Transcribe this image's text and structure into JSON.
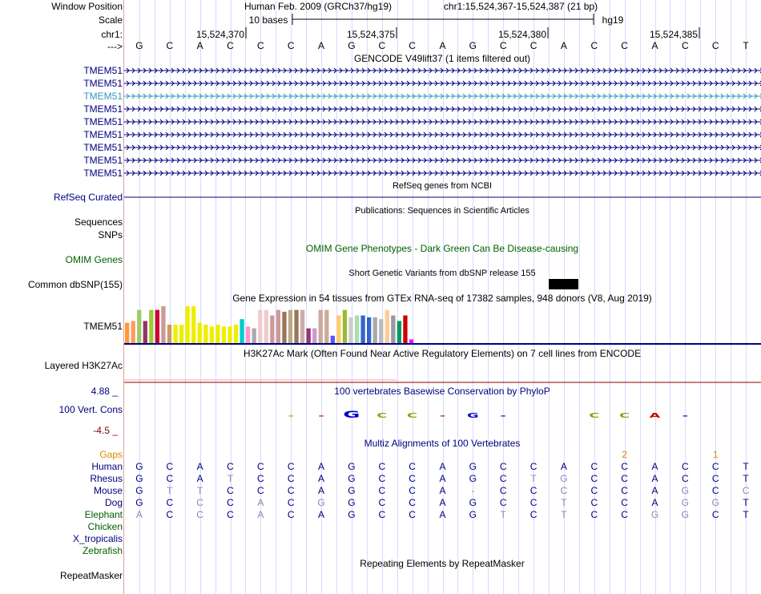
{
  "header": {
    "window_position_label": "Window Position",
    "assembly": "Human Feb. 2009 (GRCh37/hg19)",
    "position": "chr1:15,524,367-15,524,387 (21 bp)",
    "scale_label": "Scale",
    "scale_text": "10 bases",
    "scale_db": "hg19",
    "chrom_label": "chr1:",
    "strand_label": "--->",
    "ticks": [
      "15,524,370",
      "15,524,375",
      "15,524,380",
      "15,524,385"
    ]
  },
  "sequence": [
    "G",
    "C",
    "A",
    "C",
    "C",
    "C",
    "A",
    "G",
    "C",
    "C",
    "A",
    "G",
    "C",
    "C",
    "A",
    "C",
    "C",
    "A",
    "C",
    "C",
    "T"
  ],
  "gencode": {
    "title": "GENCODE V49lift37 (1 items filtered out)",
    "items": [
      "TMEM51",
      "TMEM51",
      "TMEM51",
      "TMEM51",
      "TMEM51",
      "TMEM51",
      "TMEM51",
      "TMEM51",
      "TMEM51"
    ],
    "highlight_index": 2
  },
  "refseq": {
    "title": "RefSeq genes from NCBI",
    "label": "RefSeq Curated"
  },
  "publications": {
    "title": "Publications: Sequences in Scientific Articles",
    "labels": [
      "Sequences",
      "SNPs"
    ]
  },
  "omim": {
    "title": "OMIM Gene Phenotypes - Dark Green Can Be Disease-causing",
    "label": "OMIM Genes"
  },
  "dbsnp": {
    "title": "Short Genetic Variants from dbSNP release 155",
    "label": "Common dbSNP(155)"
  },
  "gtex": {
    "title": "Gene Expression in 54 tissues from GTEx RNA-seq of 17382 samples, 948 donors (V8, Aug 2019)",
    "label": "TMEM51",
    "bars": [
      {
        "v": 0.55,
        "c": "#ff9933"
      },
      {
        "v": 0.6,
        "c": "#ff9966"
      },
      {
        "v": 0.9,
        "c": "#99cc66"
      },
      {
        "v": 0.6,
        "c": "#993366"
      },
      {
        "v": 0.9,
        "c": "#99cc33"
      },
      {
        "v": 0.9,
        "c": "#cc0033"
      },
      {
        "v": 1.0,
        "c": "#cc9999"
      },
      {
        "v": 0.5,
        "c": "#cc9966"
      },
      {
        "v": 0.5,
        "c": "#eeee00"
      },
      {
        "v": 0.5,
        "c": "#eeee00"
      },
      {
        "v": 1.0,
        "c": "#eeee00"
      },
      {
        "v": 1.0,
        "c": "#eeee00"
      },
      {
        "v": 0.55,
        "c": "#eeee00"
      },
      {
        "v": 0.5,
        "c": "#eeee00"
      },
      {
        "v": 0.45,
        "c": "#eeee00"
      },
      {
        "v": 0.5,
        "c": "#eeee00"
      },
      {
        "v": 0.45,
        "c": "#eeee00"
      },
      {
        "v": 0.45,
        "c": "#eeee00"
      },
      {
        "v": 0.5,
        "c": "#eeee00"
      },
      {
        "v": 0.65,
        "c": "#00cccc"
      },
      {
        "v": 0.45,
        "c": "#ff99cc"
      },
      {
        "v": 0.4,
        "c": "#aaaaaa"
      },
      {
        "v": 0.9,
        "c": "#eecccc"
      },
      {
        "v": 0.9,
        "c": "#eecccc"
      },
      {
        "v": 0.75,
        "c": "#cc9999"
      },
      {
        "v": 0.9,
        "c": "#cc9999"
      },
      {
        "v": 0.85,
        "c": "#997755"
      },
      {
        "v": 0.9,
        "c": "#bbaa88"
      },
      {
        "v": 0.9,
        "c": "#997755"
      },
      {
        "v": 0.9,
        "c": "#ccaaaa"
      },
      {
        "v": 0.4,
        "c": "#993377"
      },
      {
        "v": 0.4,
        "c": "#cc99cc"
      },
      {
        "v": 0.9,
        "c": "#ccaa99"
      },
      {
        "v": 0.9,
        "c": "#ccaa99"
      },
      {
        "v": 0.2,
        "c": "#5555ff"
      },
      {
        "v": 0.75,
        "c": "#ffcc66"
      },
      {
        "v": 0.9,
        "c": "#99bb33"
      },
      {
        "v": 0.7,
        "c": "#cccccc"
      },
      {
        "v": 0.75,
        "c": "#aaddaa"
      },
      {
        "v": 0.75,
        "c": "#3366cc"
      },
      {
        "v": 0.7,
        "c": "#3366cc"
      },
      {
        "v": 0.7,
        "c": "#aaaaaa"
      },
      {
        "v": 0.65,
        "c": "#bbbbbb"
      },
      {
        "v": 0.9,
        "c": "#ffcc99"
      },
      {
        "v": 0.75,
        "c": "#999999"
      },
      {
        "v": 0.6,
        "c": "#009966"
      },
      {
        "v": 0.75,
        "c": "#cc0000"
      },
      {
        "v": 0.1,
        "c": "#ff00ff"
      }
    ]
  },
  "h3k27ac": {
    "title": "H3K27Ac Mark (Often Found Near Active Regulatory Elements) on 7 cell lines from ENCODE",
    "label": "Layered H3K27Ac"
  },
  "phylop": {
    "title": "100 vertebrates Basewise Conservation by PhyloP",
    "label": "100 Vert. Cons",
    "max_label": "4.88 _",
    "min_label": "-4.5 _",
    "colors": {
      "blue": "#0000cc",
      "olive": "#999900",
      "red": "#cc0000"
    }
  },
  "multiz": {
    "title": "Multiz Alignments of 100 Vertebrates",
    "gaps_label": "Gaps",
    "gap_numbers": [
      {
        "index": 16,
        "n": "2"
      },
      {
        "index": 19,
        "n": "1"
      }
    ],
    "species": [
      {
        "name": "Human",
        "row": [
          "G",
          "C",
          "A",
          "C",
          "C",
          "C",
          "A",
          "G",
          "C",
          "C",
          "A",
          "G",
          "C",
          "C",
          "A",
          "C",
          "C",
          "A",
          "C",
          "C",
          "T"
        ],
        "dim": []
      },
      {
        "name": "Rhesus",
        "row": [
          "G",
          "C",
          "A",
          "T",
          "C",
          "C",
          "A",
          "G",
          "C",
          "C",
          "A",
          "G",
          "C",
          "T",
          "G",
          "C",
          "C",
          "A",
          "C",
          "C",
          "T"
        ],
        "dim": [
          3,
          13,
          14
        ]
      },
      {
        "name": "Mouse",
        "row": [
          "G",
          "T",
          "T",
          "C",
          "C",
          "C",
          "A",
          "G",
          "C",
          "C",
          "A",
          "-",
          "C",
          "C",
          "C",
          "C",
          "C",
          "A",
          "G",
          "C",
          "C"
        ],
        "dim": [
          1,
          2,
          11,
          14,
          18,
          20
        ]
      },
      {
        "name": "Dog",
        "row": [
          "G",
          "C",
          "C",
          "C",
          "A",
          "C",
          "G",
          "G",
          "C",
          "C",
          "A",
          "G",
          "C",
          "C",
          "T",
          "C",
          "C",
          "A",
          "G",
          "G",
          "T"
        ],
        "dim": [
          2,
          4,
          6,
          14,
          18,
          19
        ]
      },
      {
        "name": "Elephant",
        "row": [
          "A",
          "C",
          "C",
          "C",
          "A",
          "C",
          "A",
          "G",
          "C",
          "C",
          "A",
          "G",
          "T",
          "C",
          "T",
          "C",
          "C",
          "G",
          "G",
          "C",
          "T"
        ],
        "dim": [
          0,
          2,
          4,
          12,
          14,
          17,
          18
        ]
      },
      {
        "name": "Chicken",
        "row": [],
        "dim": []
      },
      {
        "name": "X_tropicalis",
        "row": [],
        "dim": []
      },
      {
        "name": "Zebrafish",
        "row": [],
        "dim": []
      }
    ]
  },
  "repeatmasker": {
    "title": "Repeating Elements by RepeatMasker",
    "label": "RepeatMasker"
  }
}
